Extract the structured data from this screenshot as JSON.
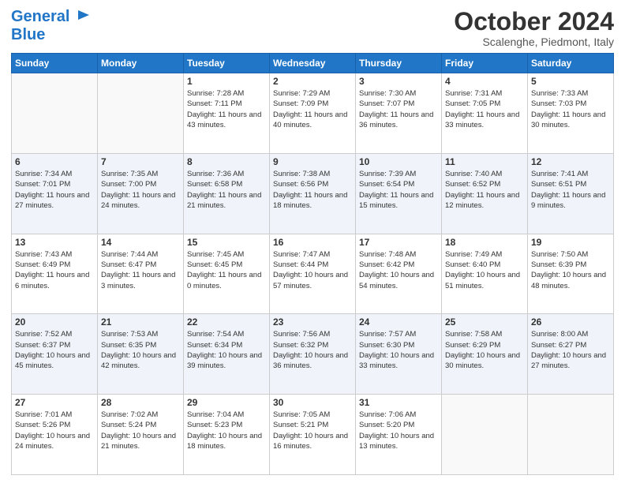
{
  "header": {
    "logo_line1": "General",
    "logo_line2": "Blue",
    "month": "October 2024",
    "location": "Scalenghe, Piedmont, Italy"
  },
  "days_of_week": [
    "Sunday",
    "Monday",
    "Tuesday",
    "Wednesday",
    "Thursday",
    "Friday",
    "Saturday"
  ],
  "weeks": [
    [
      {
        "num": "",
        "info": ""
      },
      {
        "num": "",
        "info": ""
      },
      {
        "num": "1",
        "info": "Sunrise: 7:28 AM\nSunset: 7:11 PM\nDaylight: 11 hours and 43 minutes."
      },
      {
        "num": "2",
        "info": "Sunrise: 7:29 AM\nSunset: 7:09 PM\nDaylight: 11 hours and 40 minutes."
      },
      {
        "num": "3",
        "info": "Sunrise: 7:30 AM\nSunset: 7:07 PM\nDaylight: 11 hours and 36 minutes."
      },
      {
        "num": "4",
        "info": "Sunrise: 7:31 AM\nSunset: 7:05 PM\nDaylight: 11 hours and 33 minutes."
      },
      {
        "num": "5",
        "info": "Sunrise: 7:33 AM\nSunset: 7:03 PM\nDaylight: 11 hours and 30 minutes."
      }
    ],
    [
      {
        "num": "6",
        "info": "Sunrise: 7:34 AM\nSunset: 7:01 PM\nDaylight: 11 hours and 27 minutes."
      },
      {
        "num": "7",
        "info": "Sunrise: 7:35 AM\nSunset: 7:00 PM\nDaylight: 11 hours and 24 minutes."
      },
      {
        "num": "8",
        "info": "Sunrise: 7:36 AM\nSunset: 6:58 PM\nDaylight: 11 hours and 21 minutes."
      },
      {
        "num": "9",
        "info": "Sunrise: 7:38 AM\nSunset: 6:56 PM\nDaylight: 11 hours and 18 minutes."
      },
      {
        "num": "10",
        "info": "Sunrise: 7:39 AM\nSunset: 6:54 PM\nDaylight: 11 hours and 15 minutes."
      },
      {
        "num": "11",
        "info": "Sunrise: 7:40 AM\nSunset: 6:52 PM\nDaylight: 11 hours and 12 minutes."
      },
      {
        "num": "12",
        "info": "Sunrise: 7:41 AM\nSunset: 6:51 PM\nDaylight: 11 hours and 9 minutes."
      }
    ],
    [
      {
        "num": "13",
        "info": "Sunrise: 7:43 AM\nSunset: 6:49 PM\nDaylight: 11 hours and 6 minutes."
      },
      {
        "num": "14",
        "info": "Sunrise: 7:44 AM\nSunset: 6:47 PM\nDaylight: 11 hours and 3 minutes."
      },
      {
        "num": "15",
        "info": "Sunrise: 7:45 AM\nSunset: 6:45 PM\nDaylight: 11 hours and 0 minutes."
      },
      {
        "num": "16",
        "info": "Sunrise: 7:47 AM\nSunset: 6:44 PM\nDaylight: 10 hours and 57 minutes."
      },
      {
        "num": "17",
        "info": "Sunrise: 7:48 AM\nSunset: 6:42 PM\nDaylight: 10 hours and 54 minutes."
      },
      {
        "num": "18",
        "info": "Sunrise: 7:49 AM\nSunset: 6:40 PM\nDaylight: 10 hours and 51 minutes."
      },
      {
        "num": "19",
        "info": "Sunrise: 7:50 AM\nSunset: 6:39 PM\nDaylight: 10 hours and 48 minutes."
      }
    ],
    [
      {
        "num": "20",
        "info": "Sunrise: 7:52 AM\nSunset: 6:37 PM\nDaylight: 10 hours and 45 minutes."
      },
      {
        "num": "21",
        "info": "Sunrise: 7:53 AM\nSunset: 6:35 PM\nDaylight: 10 hours and 42 minutes."
      },
      {
        "num": "22",
        "info": "Sunrise: 7:54 AM\nSunset: 6:34 PM\nDaylight: 10 hours and 39 minutes."
      },
      {
        "num": "23",
        "info": "Sunrise: 7:56 AM\nSunset: 6:32 PM\nDaylight: 10 hours and 36 minutes."
      },
      {
        "num": "24",
        "info": "Sunrise: 7:57 AM\nSunset: 6:30 PM\nDaylight: 10 hours and 33 minutes."
      },
      {
        "num": "25",
        "info": "Sunrise: 7:58 AM\nSunset: 6:29 PM\nDaylight: 10 hours and 30 minutes."
      },
      {
        "num": "26",
        "info": "Sunrise: 8:00 AM\nSunset: 6:27 PM\nDaylight: 10 hours and 27 minutes."
      }
    ],
    [
      {
        "num": "27",
        "info": "Sunrise: 7:01 AM\nSunset: 5:26 PM\nDaylight: 10 hours and 24 minutes."
      },
      {
        "num": "28",
        "info": "Sunrise: 7:02 AM\nSunset: 5:24 PM\nDaylight: 10 hours and 21 minutes."
      },
      {
        "num": "29",
        "info": "Sunrise: 7:04 AM\nSunset: 5:23 PM\nDaylight: 10 hours and 18 minutes."
      },
      {
        "num": "30",
        "info": "Sunrise: 7:05 AM\nSunset: 5:21 PM\nDaylight: 10 hours and 16 minutes."
      },
      {
        "num": "31",
        "info": "Sunrise: 7:06 AM\nSunset: 5:20 PM\nDaylight: 10 hours and 13 minutes."
      },
      {
        "num": "",
        "info": ""
      },
      {
        "num": "",
        "info": ""
      }
    ]
  ]
}
